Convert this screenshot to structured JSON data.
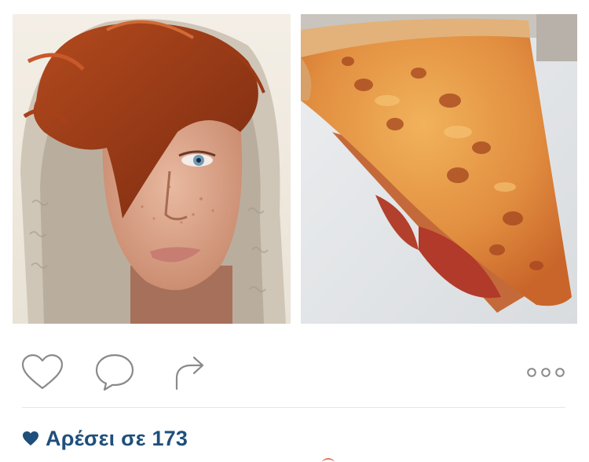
{
  "post": {
    "images": [
      {
        "description_icon": "portrait-photo"
      },
      {
        "description_icon": "pizza-photo"
      }
    ],
    "actions": {
      "like_icon": "heart-outline-icon",
      "comment_icon": "speech-bubble-icon",
      "share_icon": "share-arrow-icon",
      "more_icon": "ellipsis-icon"
    },
    "likes": {
      "text": "Αρέσει σε 173",
      "color": "#1f4f7b"
    }
  }
}
